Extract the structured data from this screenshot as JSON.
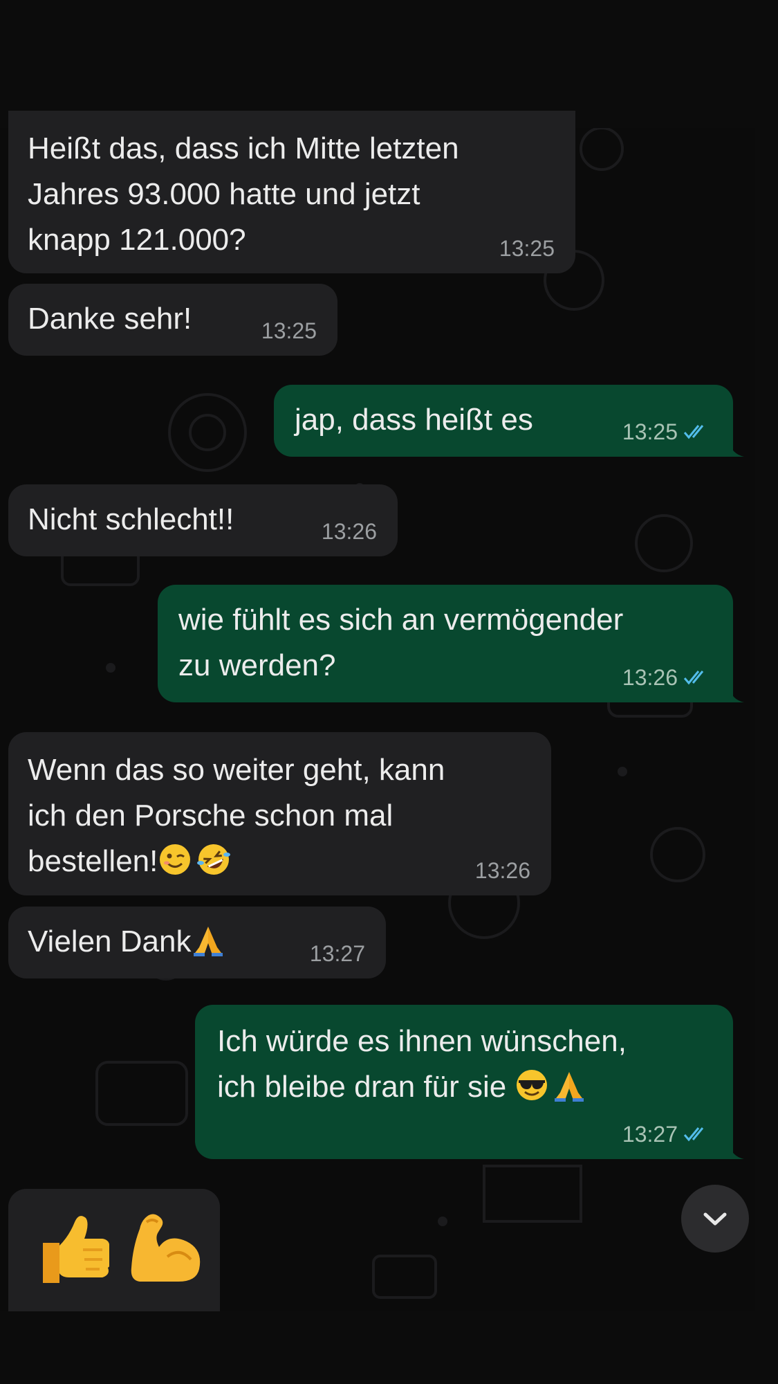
{
  "messages": [
    {
      "dir": "in",
      "text": "Heißt das, dass ich Mitte letzten\nJahres 93.000 hatte und jetzt\nknapp 121.000?",
      "time": "13:25"
    },
    {
      "dir": "in",
      "text": "Danke sehr!",
      "time": "13:25"
    },
    {
      "dir": "out",
      "text": "jap, dass heißt es",
      "time": "13:25",
      "status": "read"
    },
    {
      "dir": "in",
      "text": "Nicht schlecht!!",
      "time": "13:26"
    },
    {
      "dir": "out",
      "text": "wie fühlt es sich an vermögender\nzu werden?",
      "time": "13:26",
      "status": "read"
    },
    {
      "dir": "in",
      "text": "Wenn das so weiter geht, kann\nich den Porsche schon mal\nbestellen!",
      "emojis": [
        "winking-face",
        "rolling-on-floor-laughing"
      ],
      "time": "13:26"
    },
    {
      "dir": "in",
      "text": "Vielen Dank",
      "emojis": [
        "folded-hands"
      ],
      "time": "13:27"
    },
    {
      "dir": "out",
      "text": "Ich würde es ihnen wünschen,\nich bleibe dran für sie ",
      "emojis": [
        "smiling-face-with-sunglasses",
        "folded-hands"
      ],
      "time": "13:27",
      "status": "read"
    },
    {
      "dir": "in",
      "emojis": [
        "thumbs-up",
        "flexed-biceps"
      ]
    }
  ],
  "icons": {
    "read_receipt": "double-check-icon",
    "scroll_down": "chevron-down-icon"
  },
  "colors": {
    "incoming_bubble": "#202022",
    "outgoing_bubble": "#08482f",
    "read_tick": "#53bdeb",
    "background": "#0b0b0b"
  }
}
